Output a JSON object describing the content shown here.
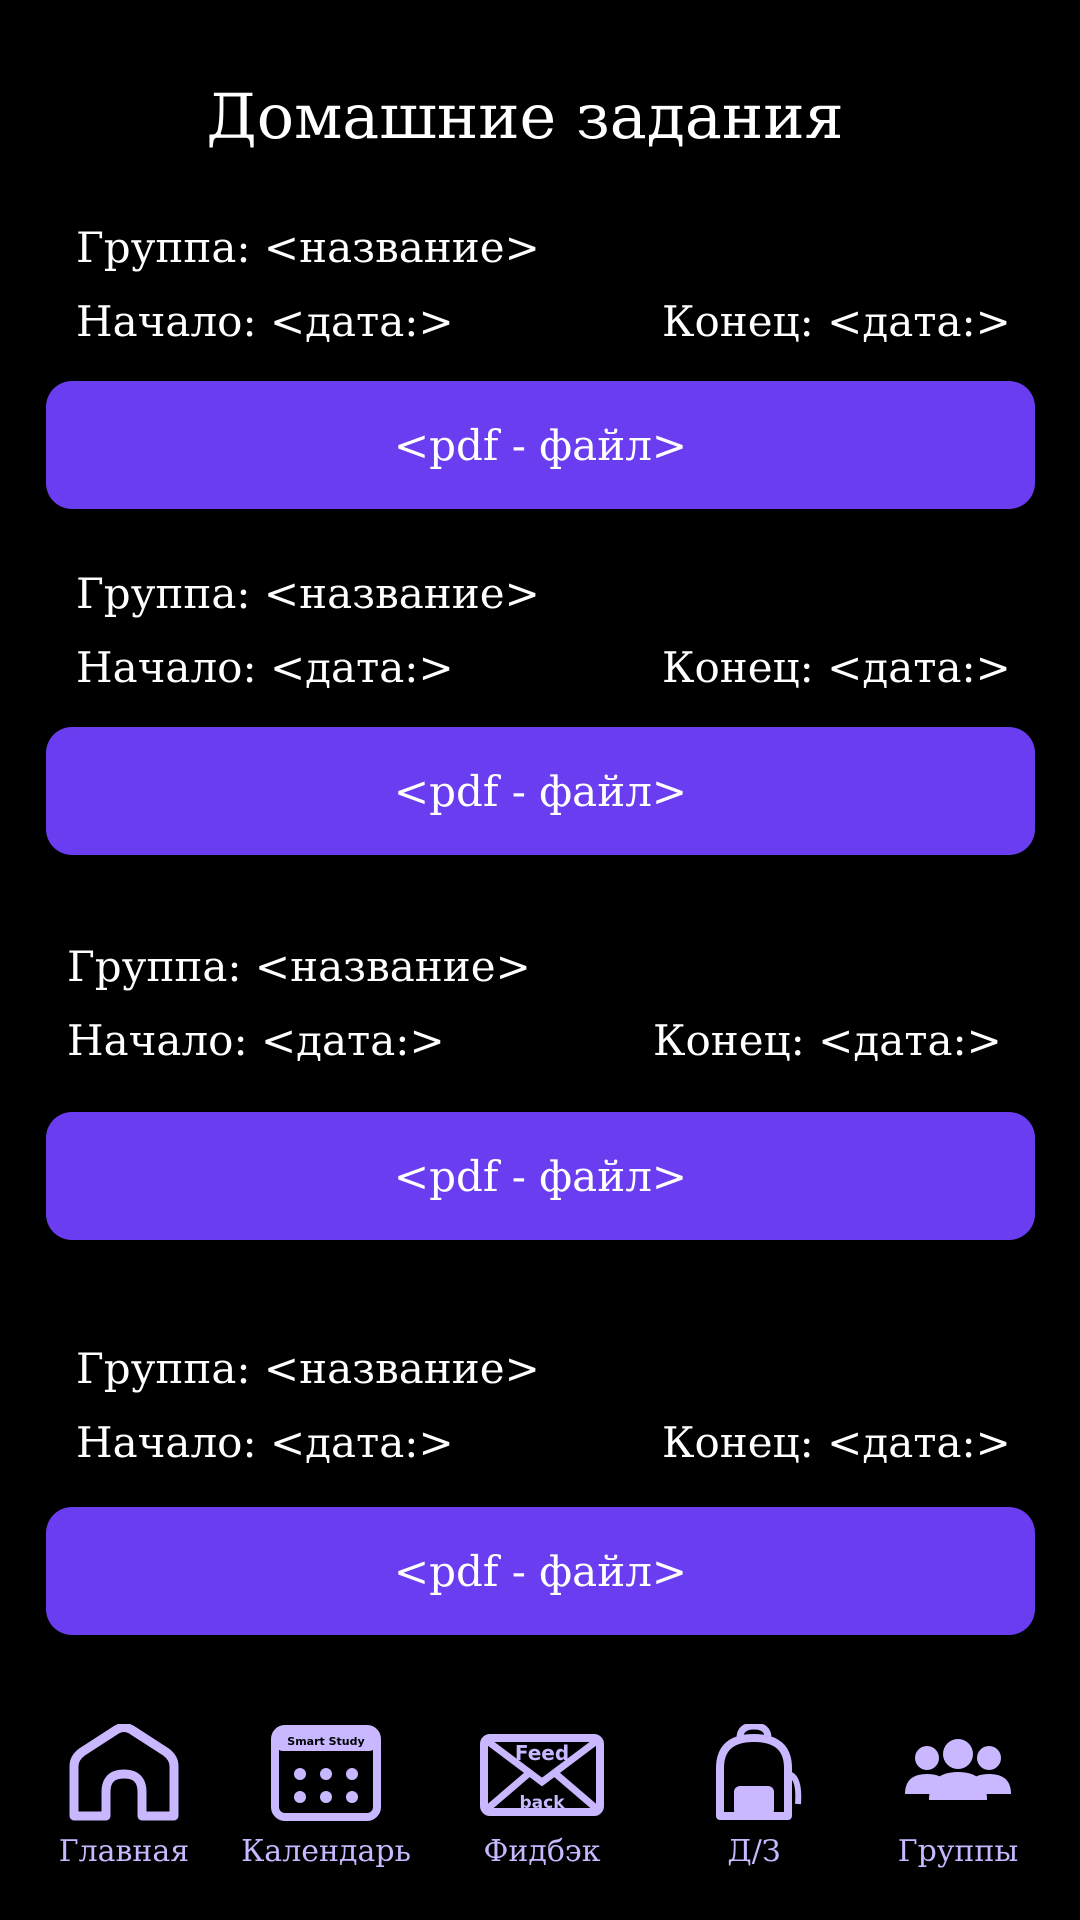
{
  "page": {
    "title": "Домашние задания"
  },
  "colors": {
    "accent": "#6a3df0",
    "nav_icon": "#c9b8ff",
    "background": "#000000"
  },
  "assignments": [
    {
      "group": "Группа: <название>",
      "start": "Начало: <дата:>",
      "end": "Конец: <дата:>",
      "file": "<pdf - файл>"
    },
    {
      "group": "Группа: <название>",
      "start": "Начало: <дата:>",
      "end": "Конец: <дата:>",
      "file": "<pdf - файл>"
    },
    {
      "group": "Группа: <название>",
      "start": "Начало: <дата:>",
      "end": "Конец: <дата:>",
      "file": "<pdf - файл>"
    },
    {
      "group": "Группа: <название>",
      "start": "Начало: <дата:>",
      "end": "Конец: <дата:>",
      "file": "<pdf - файл>"
    }
  ],
  "nav": {
    "items": [
      {
        "label": "Главная",
        "icon": "home-icon"
      },
      {
        "label": "Календарь",
        "icon": "calendar-icon",
        "icon_text": "Smart Study"
      },
      {
        "label": "Фидбэк",
        "icon": "feedback-envelope-icon",
        "icon_text_top": "Feed",
        "icon_text_bottom": "back"
      },
      {
        "label": "Д/З",
        "icon": "backpack-icon"
      },
      {
        "label": "Группы",
        "icon": "groups-icon"
      }
    ]
  }
}
